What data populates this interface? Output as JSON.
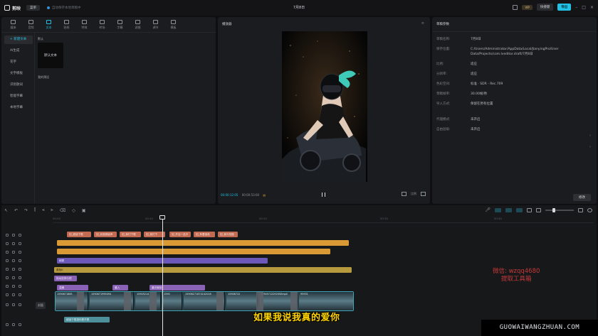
{
  "titlebar": {
    "app_name": "剪映",
    "menu_label": "菜单",
    "autosave_status": "自动保存本地草稿中",
    "project_title": "7月8日",
    "vip_label": "VIP",
    "shortcut_label": "快捷键",
    "export_label": "导出"
  },
  "tools": [
    {
      "label": "媒体"
    },
    {
      "label": "音频"
    },
    {
      "label": "文本"
    },
    {
      "label": "贴纸"
    },
    {
      "label": "特效"
    },
    {
      "label": "转场"
    },
    {
      "label": "字幕"
    },
    {
      "label": "滤镜"
    },
    {
      "label": "调节"
    },
    {
      "label": "模板"
    }
  ],
  "sidebar": {
    "items": [
      {
        "label": "+ 新建文本"
      },
      {
        "label": "AI生成"
      },
      {
        "label": "花字"
      },
      {
        "label": "文字模板"
      },
      {
        "label": "识别歌词"
      },
      {
        "label": "智能字幕"
      },
      {
        "label": "本地字幕"
      }
    ],
    "section_default": "默认",
    "default_text_tile": "默认文本",
    "section_my_presets": "我的预设"
  },
  "player": {
    "title": "播放器",
    "timecode_current": "00:00:12:05",
    "timecode_total": "00:00:53:00",
    "ratio_label": "比例"
  },
  "draft_params": {
    "title": "草稿参数",
    "rows": [
      {
        "key": "草稿名称:",
        "value": "7月8日"
      },
      {
        "key": "保存位置:",
        "value": "C:/Users/Administrator/AppData/Local/JianyingPro/User Data/Projects/com.lveditor.draft/7月8日"
      },
      {
        "key": "比例:",
        "value": "适应"
      },
      {
        "key": "分辨率:",
        "value": "适应"
      },
      {
        "key": "色彩空间:",
        "value": "标准 · SDR - Rec.709"
      },
      {
        "key": "草稿帧率:",
        "value": "30.00帧/秒"
      },
      {
        "key": "导入方式:",
        "value": "保留在原有位置"
      },
      {
        "key": "代理模式:",
        "value": "未开启"
      },
      {
        "key": "自由层级:",
        "value": "未开启"
      }
    ],
    "modify_label": "修改"
  },
  "timeline": {
    "ruler_labels": [
      "00:00",
      "00:10",
      "00:20",
      "00:30",
      "00:40"
    ],
    "cover_label": "封面",
    "tracks": {
      "red_clips": [
        "如_超适下载",
        "如_创造超级声",
        "如_我们下载",
        "如_我们下",
        "如_开启一品字",
        "如_有着保真",
        "如_我与拍摄"
      ],
      "purple_clip": "朝雾",
      "gold_clip": "原色K",
      "violet_small": "拖动选择分镜",
      "row_small_1": "温暖",
      "row_small_2": "晨入",
      "row_small_3": "晨光缩放",
      "video_labels": [
        "1590671865",
        "1590671999494",
        "15905214",
        "1590",
        "15906271874142016",
        "15906722",
        "15905712292050mp4",
        "95931"
      ],
      "bottom_clip": "超适下载语你是不是"
    }
  },
  "overlays": {
    "subtitle": "如果我说我真的爱你",
    "watermark_line1": "微信: wzqq4680",
    "watermark_line2": "提取工具箱",
    "domain_banner": "GUOWAIWANGZHUAN.COM"
  }
}
